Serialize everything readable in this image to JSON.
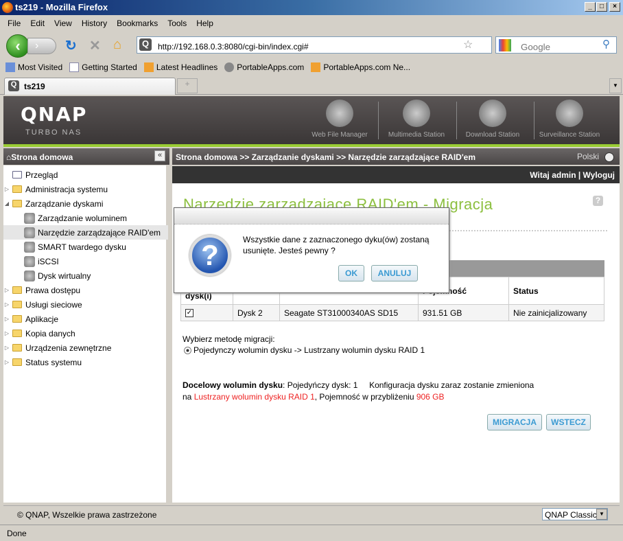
{
  "window": {
    "title": "ts219 - Mozilla Firefox"
  },
  "menu": [
    "File",
    "Edit",
    "View",
    "History",
    "Bookmarks",
    "Tools",
    "Help"
  ],
  "url": "http://192.168.0.3:8080/cgi-bin/index.cgi#",
  "search_placeholder": "Google",
  "bookmarks": [
    "Most Visited",
    "Getting Started",
    "Latest Headlines",
    "PortableApps.com",
    "PortableApps.com Ne..."
  ],
  "tab": {
    "title": "ts219"
  },
  "header": {
    "logo": "QNAP",
    "subtitle": "TURBO NAS",
    "apps": [
      "Web File Manager",
      "Multimedia Station",
      "Download Station",
      "Surveillance Station"
    ]
  },
  "sidebar": {
    "title": "Strona domowa",
    "items": [
      {
        "label": "Przegląd"
      },
      {
        "label": "Administracja systemu"
      },
      {
        "label": "Zarządzanie dyskami"
      },
      {
        "label": "Zarządzanie woluminem"
      },
      {
        "label": "Narzędzie zarządzające RAID'em"
      },
      {
        "label": "SMART twardego dysku"
      },
      {
        "label": "iSCSI"
      },
      {
        "label": "Dysk wirtualny"
      },
      {
        "label": "Prawa dostępu"
      },
      {
        "label": "Usługi sieciowe"
      },
      {
        "label": "Aplikacje"
      },
      {
        "label": "Kopia danych"
      },
      {
        "label": "Urządzenia zewnętrzne"
      },
      {
        "label": "Status systemu"
      }
    ]
  },
  "breadcrumb": "Strona domowa >> Zarządzanie dyskami >> Narzędzie zarządzające RAID'em",
  "language": "Polski",
  "welcome": "Witaj admin | Wyloguj",
  "page": {
    "title": "Narzedzie zarzadzajace RAID'em - Migracja",
    "table": {
      "headers": [
        "dysk(i)",
        "",
        "",
        "Pojemność",
        "Status"
      ],
      "rows": [
        {
          "checked": true,
          "disk": "Dysk 2",
          "model": "Seagate ST31000340AS SD15",
          "capacity": "931.51 GB",
          "status": "Nie zainicjalizowany"
        }
      ]
    },
    "choose_label": "Wybierz metodę migracji:",
    "option": "Pojedynczy wolumin dysku -> Lustrzany wolumin dysku RAID 1",
    "target_label": "Docelowy wolumin dysku",
    "target_text1": ": Pojedyńczy dysk: 1     Konfiguracja dysku zaraz zostanie zmieniona",
    "target_na": "na ",
    "target_red1": "Lustrzany wolumin dysku RAID 1",
    "target_text2": ", Pojemność w przybliżeniu ",
    "target_red2": "906 GB",
    "migrate_btn": "MIGRACJA",
    "back_btn": "WSTECZ"
  },
  "dialog": {
    "message": "Wszystkie dane z zaznaczonego dyku(ów) zostaną usunięte. Jesteś pewny ?",
    "ok": "OK",
    "cancel": "ANULUJ"
  },
  "footer": {
    "copyright": "© QNAP, Wszelkie prawa zastrzeżone",
    "theme": "QNAP Classic"
  },
  "status": "Done"
}
